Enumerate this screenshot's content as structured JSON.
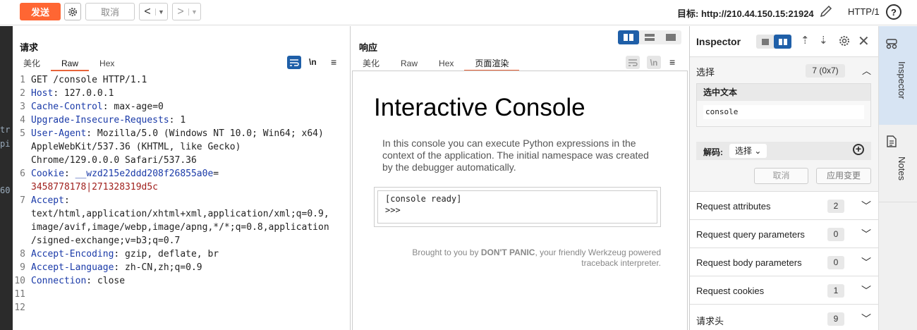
{
  "toolbar": {
    "send": "发送",
    "cancel": "取消",
    "target_label": "目标: http://210.44.150.15:21924",
    "http_version": "HTTP/1"
  },
  "strip": [
    "tr",
    "pi",
    "60"
  ],
  "request": {
    "title": "请求",
    "tabs": [
      "美化",
      "Raw",
      "Hex"
    ],
    "active_tab": "Raw",
    "newline_toggle": "\\n",
    "lines": [
      {
        "n": "1",
        "parts": [
          {
            "t": "GET /console HTTP/1.1",
            "c": "val"
          }
        ]
      },
      {
        "n": "2",
        "parts": [
          {
            "t": "Host",
            "c": "key"
          },
          {
            "t": ": 127.0.0.1",
            "c": "val"
          }
        ]
      },
      {
        "n": "3",
        "parts": [
          {
            "t": "Cache-Control",
            "c": "key"
          },
          {
            "t": ": max-age=0",
            "c": "val"
          }
        ]
      },
      {
        "n": "4",
        "parts": [
          {
            "t": "Upgrade-Insecure-Requests",
            "c": "key"
          },
          {
            "t": ": 1",
            "c": "val"
          }
        ]
      },
      {
        "n": "5",
        "parts": [
          {
            "t": "User-Agent",
            "c": "key"
          },
          {
            "t": ": Mozilla/5.0 (Windows NT 10.0; Win64; x64)",
            "c": "val"
          }
        ]
      },
      {
        "n": "",
        "parts": [
          {
            "t": "AppleWebKit/537.36 (KHTML, like Gecko)",
            "c": "val"
          }
        ]
      },
      {
        "n": "",
        "parts": [
          {
            "t": "Chrome/129.0.0.0 Safari/537.36",
            "c": "val"
          }
        ]
      },
      {
        "n": "6",
        "parts": [
          {
            "t": "Cookie",
            "c": "key"
          },
          {
            "t": ": ",
            "c": "val"
          },
          {
            "t": "__wzd215e2ddd208f26855a0e",
            "c": "key"
          },
          {
            "t": "=",
            "c": "val"
          }
        ]
      },
      {
        "n": "",
        "parts": [
          {
            "t": "3458778178|271328319d5c",
            "c": "ckv"
          }
        ]
      },
      {
        "n": "7",
        "parts": [
          {
            "t": "Accept",
            "c": "key"
          },
          {
            "t": ":",
            "c": "val"
          }
        ]
      },
      {
        "n": "",
        "parts": [
          {
            "t": "text/html,application/xhtml+xml,application/xml;q=0.9,",
            "c": "val"
          }
        ]
      },
      {
        "n": "",
        "parts": [
          {
            "t": "image/avif,image/webp,image/apng,*/*;q=0.8,application",
            "c": "val"
          }
        ]
      },
      {
        "n": "",
        "parts": [
          {
            "t": "/signed-exchange;v=b3;q=0.7",
            "c": "val"
          }
        ]
      },
      {
        "n": "8",
        "parts": [
          {
            "t": "Accept-Encoding",
            "c": "key"
          },
          {
            "t": ": gzip, deflate, br",
            "c": "val"
          }
        ]
      },
      {
        "n": "9",
        "parts": [
          {
            "t": "Accept-Language",
            "c": "key"
          },
          {
            "t": ": zh-CN,zh;q=0.9",
            "c": "val"
          }
        ]
      },
      {
        "n": "10",
        "parts": [
          {
            "t": "Connection",
            "c": "key"
          },
          {
            "t": ": close",
            "c": "val"
          }
        ]
      },
      {
        "n": "11",
        "parts": []
      },
      {
        "n": "12",
        "parts": []
      }
    ]
  },
  "response": {
    "title": "响应",
    "tabs": [
      "美化",
      "Raw",
      "Hex",
      "页面渲染"
    ],
    "active_tab": "页面渲染",
    "newline_toggle": "\\n",
    "page": {
      "heading": "Interactive Console",
      "desc": "In this console you can execute Python expressions in the context of the application. The initial namespace was created by the debugger automatically.",
      "console_line1": "[console ready]",
      "console_line2": ">>>",
      "footer_a": "Brought to you by ",
      "footer_b": "DON'T PANIC",
      "footer_c": ", your friendly Werkzeug powered traceback interpreter."
    }
  },
  "inspector": {
    "title": "Inspector",
    "selection_label": "选择",
    "selection_count": "7 (0x7)",
    "selected_text_label": "选中文本",
    "selected_text": "console",
    "decode_label": "解码:",
    "decode_select": "选择",
    "cancel": "取消",
    "apply": "应用变更",
    "rows": [
      {
        "label": "Request attributes",
        "count": "2"
      },
      {
        "label": "Request query parameters",
        "count": "0"
      },
      {
        "label": "Request body parameters",
        "count": "0"
      },
      {
        "label": "Request cookies",
        "count": "1"
      },
      {
        "label": "请求头",
        "count": "9"
      }
    ]
  },
  "sidebar": {
    "inspector": "Inspector",
    "notes": "Notes"
  },
  "colors": {
    "accent": "#ff6633",
    "active_tab_underline": "#e8643a",
    "toggle_blue": "#1f5fa8",
    "header_key": "#1a3aa8",
    "cookie_value": "#a0201d"
  }
}
